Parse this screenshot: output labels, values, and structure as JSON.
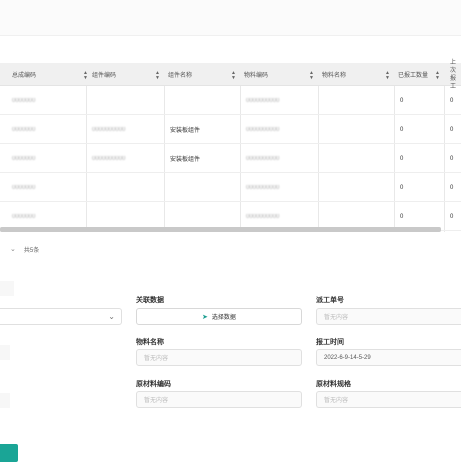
{
  "table": {
    "columns": [
      {
        "label": "总成编码",
        "sortable": true
      },
      {
        "label": "组件编码",
        "sortable": true
      },
      {
        "label": "组件名称",
        "sortable": true
      },
      {
        "label": "物料编码",
        "sortable": true
      },
      {
        "label": "物料名称",
        "sortable": true
      },
      {
        "label": "已报工数量",
        "sortable": true
      },
      {
        "label": "上次报工",
        "sortable": false
      }
    ],
    "rows": [
      [
        "0000000",
        "",
        "",
        "0000000000",
        "",
        "0",
        "0"
      ],
      [
        "0000000",
        "0000000000",
        "安装板组件",
        "0000000000",
        "",
        "0",
        "0"
      ],
      [
        "0000000",
        "0000000000",
        "安装板组件",
        "0000000000",
        "",
        "0",
        "0"
      ],
      [
        "0000000",
        "",
        "",
        "0000000000",
        "",
        "0",
        "0"
      ],
      [
        "0000000",
        "",
        "",
        "0000000000",
        "",
        "0",
        "0"
      ]
    ]
  },
  "footer": {
    "count_label": "共5条"
  },
  "form": {
    "related_label": "关联数据",
    "select_button": "选择数据",
    "dispatch_label": "派工单号",
    "dispatch_placeholder": "暂无内容",
    "material_name_label": "物料名称",
    "material_name_placeholder": "暂无内容",
    "report_time_label": "报工时间",
    "report_time_value": "2022-6-9-14-5-29",
    "raw_code_label": "原材料编码",
    "raw_code_placeholder": "暂无内容",
    "raw_spec_label": "原材料规格",
    "raw_spec_placeholder": "暂无内容"
  },
  "colors": {
    "accent": "#1aa596",
    "header_bg": "#f0f0f0"
  }
}
